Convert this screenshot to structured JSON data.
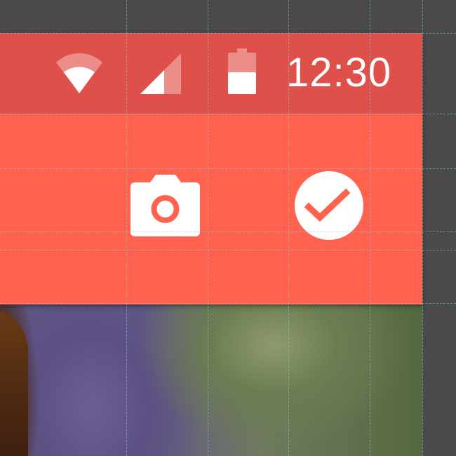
{
  "status_bar": {
    "time": "12:30",
    "icons": [
      "wifi-icon",
      "cellular-signal-icon",
      "battery-icon"
    ],
    "color": "#e0504a"
  },
  "app_bar": {
    "color": "#ff6350",
    "actions": [
      {
        "name": "camera",
        "icon": "camera-icon"
      },
      {
        "name": "done",
        "icon": "check-circle-icon"
      }
    ]
  },
  "colors": {
    "icon": "#ffffff",
    "accent": "#ff6350",
    "guide_lines": "#78d2e6",
    "canvas_background": "#4a4a4a"
  },
  "content": {
    "photo_icon": "photo-background"
  }
}
